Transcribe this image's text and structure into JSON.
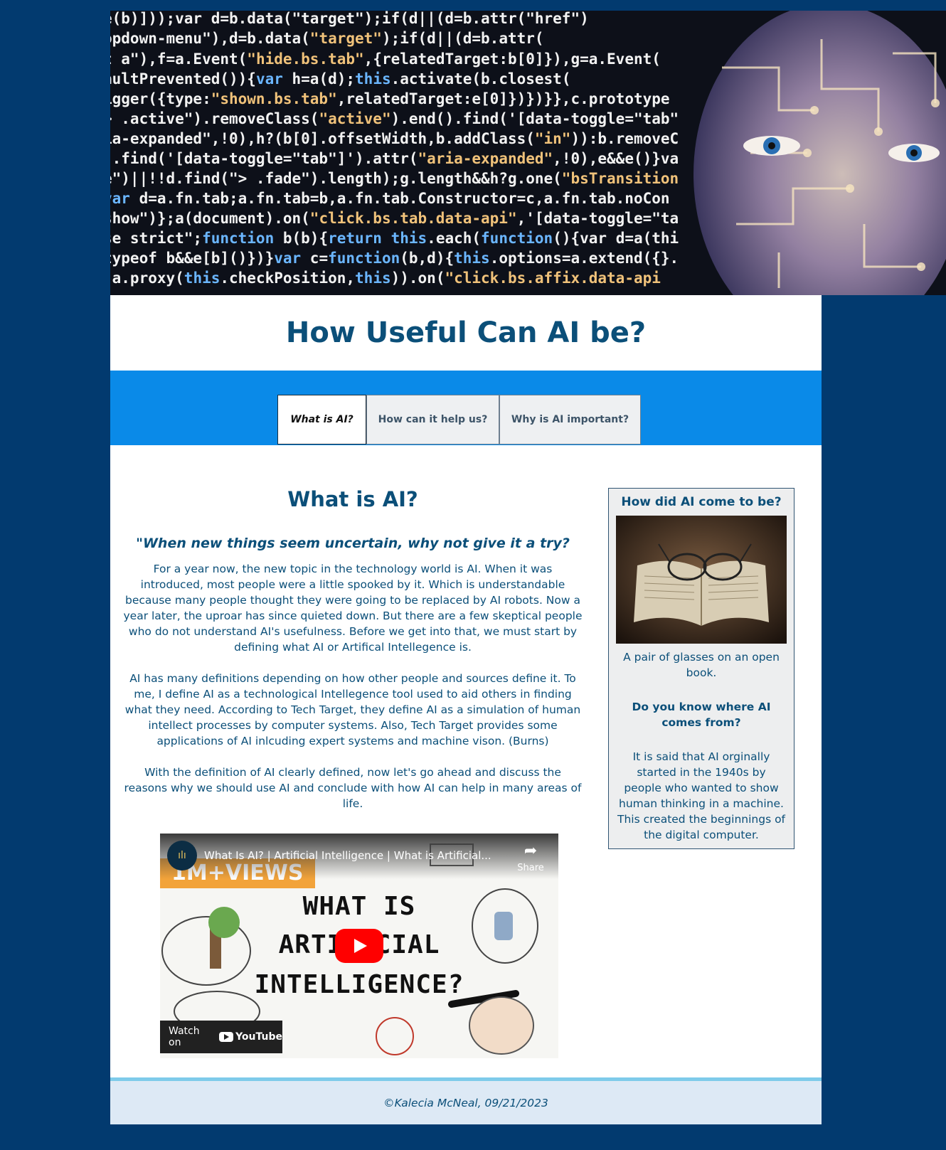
{
  "header": {
    "title": "How Useful Can AI be?"
  },
  "nav": {
    "tabs": [
      {
        "label": "What is AI?",
        "active": true
      },
      {
        "label": "How can it help us?",
        "active": false
      },
      {
        "label": "Why is AI important?",
        "active": false
      }
    ]
  },
  "main": {
    "heading": "What is AI?",
    "quote": "\"When new things seem uncertain, why not give it a try?",
    "paragraphs": [
      "For a year now, the new topic in the technology world is AI. When it was introduced, most people were a little spooked by it. Which is understandable because many people thought they were going to be replaced by AI robots. Now a year later, the uproar has since quieted down. But there are a few skeptical people who do not understand AI's usefulness. Before we get into that, we must start by defining what AI or Artifical Intellegence is.",
      "AI has many definitions depending on how other people and sources define it. To me, I define AI as a technological Intellegence tool used to aid others in finding what they need. According to Tech Target, they define AI as a simulation of human intellect processes by computer systems. Also, Tech Target provides some applications of AI inlcuding expert systems and machine vison. (Burns)",
      "With the definition of AI clearly defined, now let's go ahead and discuss the reasons why we should use AI and conclude with how AI can help in many areas of life."
    ],
    "video": {
      "title": "What Is AI? | Artificial Intelligence | What is Artificial...",
      "share_label": "Share",
      "views_banner": "1M+VIEWS",
      "thumb_line1": "WHAT IS",
      "thumb_line2": "ARTIFICIAL",
      "thumb_line3": "INTELLIGENCE?",
      "watch_label": "Watch on",
      "youtube_label": "YouTube"
    }
  },
  "sidebar": {
    "heading": "How did AI come to be?",
    "image_caption": "A pair of glasses on an open book.",
    "subheading": "Do you know where AI comes from?",
    "text": "It is said that AI orginally started in the 1940s by people who wanted to show human thinking in a machine. This created the beginnings of the digital computer."
  },
  "footer": {
    "text": "©Kalecia McNeal, 09/21/2023"
  },
  "colors": {
    "background": "#023a6f",
    "nav_bar": "#0a8ae8",
    "text": "#0b4f79",
    "footer_bg": "#dde9f5",
    "footer_border": "#7ecbea"
  }
}
